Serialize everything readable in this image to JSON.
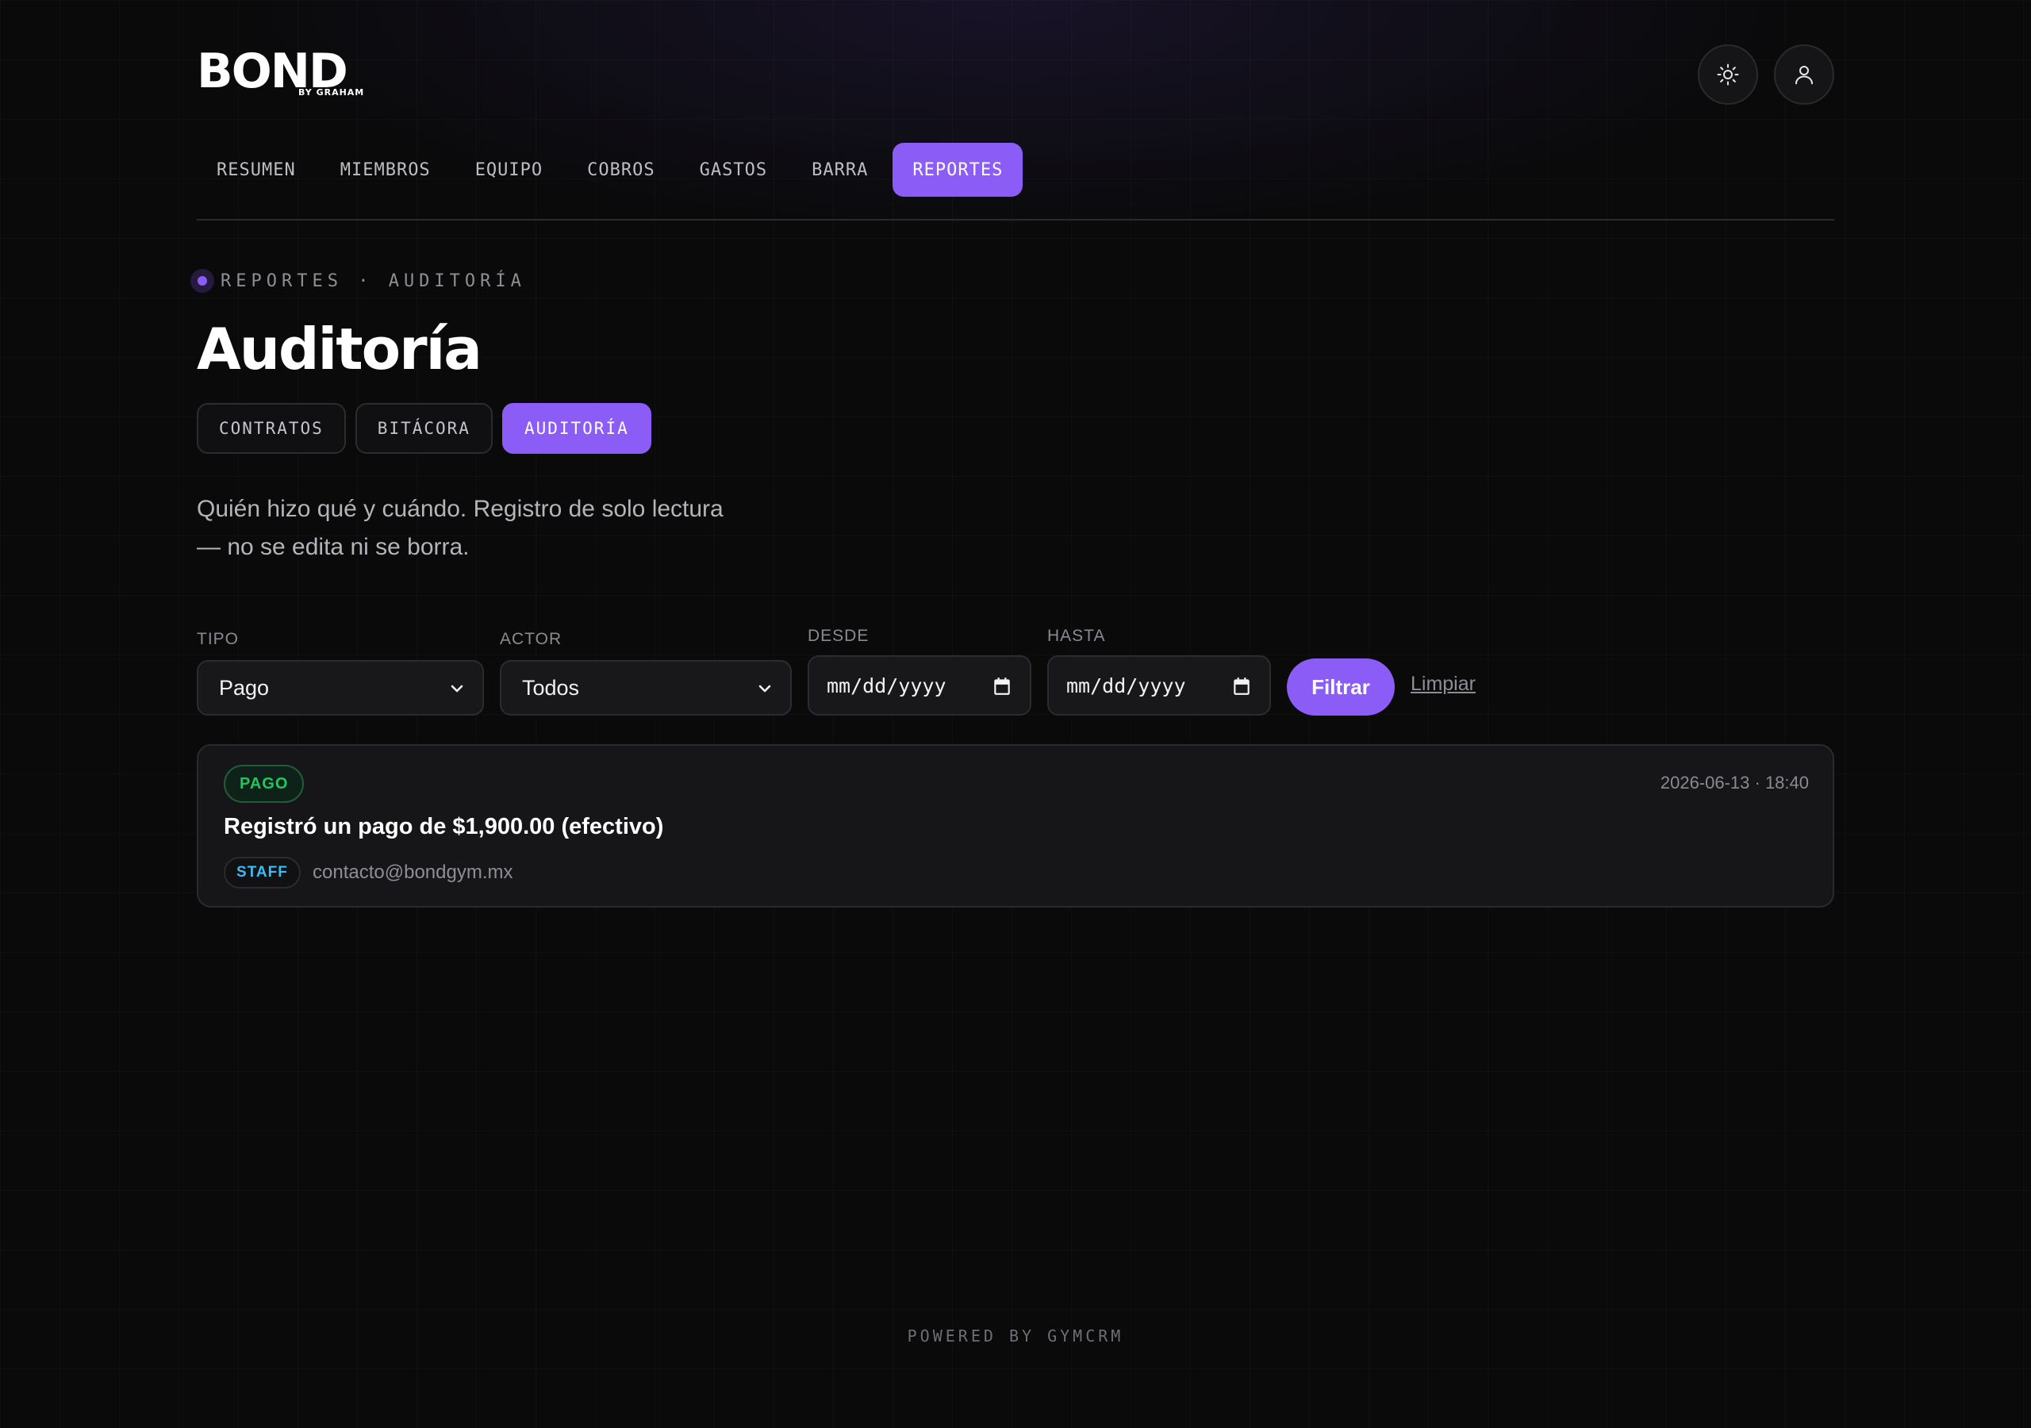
{
  "brand": {
    "logo": "BOND",
    "tagline": "BY GRAHAM"
  },
  "header": {
    "theme_toggle_icon": "sun-icon",
    "account_icon": "user-icon"
  },
  "nav": {
    "items": [
      {
        "label": "RESUMEN",
        "active": false
      },
      {
        "label": "MIEMBROS",
        "active": false
      },
      {
        "label": "EQUIPO",
        "active": false
      },
      {
        "label": "COBROS",
        "active": false
      },
      {
        "label": "GASTOS",
        "active": false
      },
      {
        "label": "BARRA",
        "active": false
      },
      {
        "label": "REPORTES",
        "active": true
      }
    ]
  },
  "breadcrumb": "REPORTES · AUDITORÍA",
  "page": {
    "title": "Auditoría",
    "description_line1": "Quién hizo qué y cuándo. Registro de solo lectura",
    "description_line2": "— no se edita ni se borra."
  },
  "sub_tabs": [
    {
      "label": "CONTRATOS",
      "active": false
    },
    {
      "label": "BITÁCORA",
      "active": false
    },
    {
      "label": "AUDITORÍA",
      "active": true
    }
  ],
  "filters": {
    "tipo_label": "TIPO",
    "tipo_value": "Pago",
    "actor_label": "ACTOR",
    "actor_value": "Todos",
    "desde_label": "DESDE",
    "desde_placeholder": "mm/dd/yyyy",
    "hasta_label": "HASTA",
    "hasta_placeholder": "mm/dd/yyyy",
    "filter_button": "Filtrar",
    "clear_link": "Limpiar"
  },
  "entries": [
    {
      "type": "PAGO",
      "timestamp": "2026-06-13 · 18:40",
      "text": "Registró un pago de $1,900.00 (efectivo)",
      "role": "STAFF",
      "actor": "contacto@bondgym.mx"
    }
  ],
  "colors": {
    "accent": "#8b5cf6",
    "background": "#0a0a0b",
    "card": "#161618",
    "success": "#22c55e",
    "info": "#38bdf8"
  },
  "footer": "POWERED BY GYMCRM"
}
